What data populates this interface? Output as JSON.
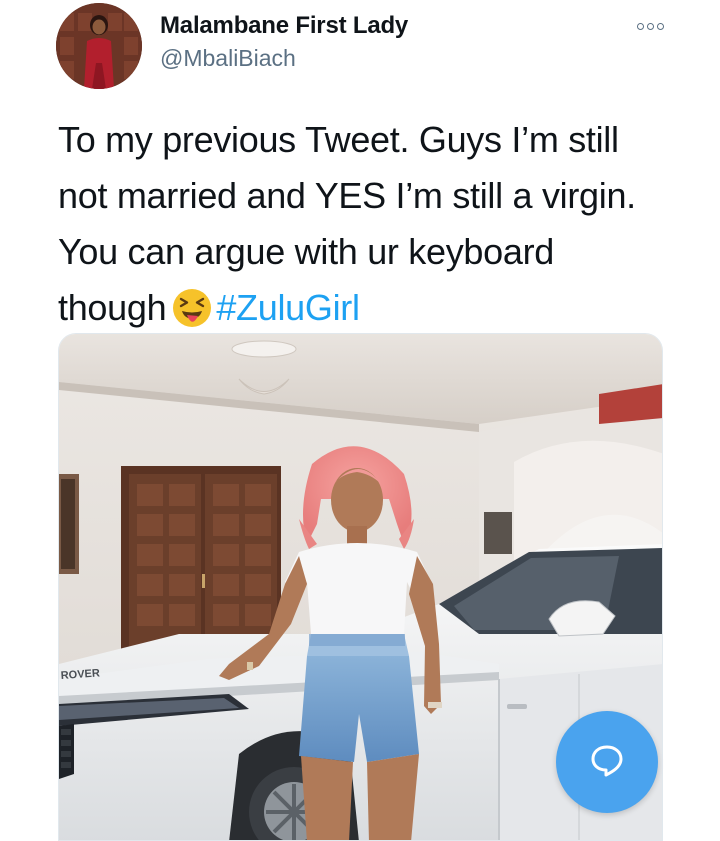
{
  "tweet": {
    "author_name": "Malambane First Lady",
    "author_handle": "@MbaliBiach",
    "text_before_emoji": "To my previous Tweet. Guys I’m still not married and YES I’m still a virgin. You can argue with ur keyboard though",
    "emoji": "squinting-face-with-tongue-icon",
    "hashtag": "#ZuluGirl"
  },
  "photo": {
    "plate_text": "ROVER"
  },
  "icons": {
    "more": "more-options-icon",
    "compose": "speech-bubble-icon"
  },
  "colors": {
    "link": "#1da1f2",
    "fab": "#4aa3ee",
    "secondary_text": "#5b7083"
  }
}
